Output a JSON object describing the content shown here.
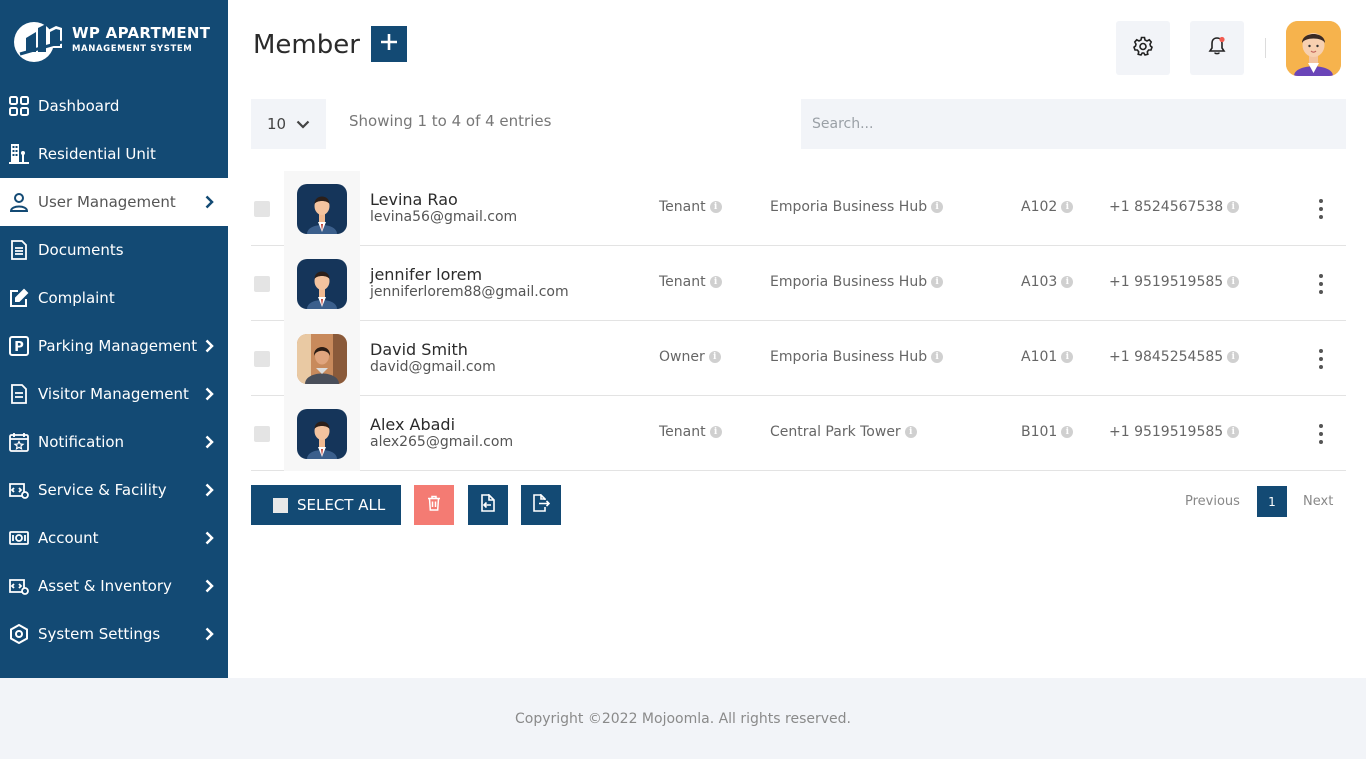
{
  "brand": {
    "title": "WP APARTMENT",
    "subtitle": "MANAGEMENT SYSTEM"
  },
  "sidebar": {
    "items": [
      {
        "label": "Dashboard",
        "icon": "dashboard-grid-icon",
        "has_chevron": false,
        "active": false
      },
      {
        "label": "Residential Unit",
        "icon": "building-icon",
        "has_chevron": false,
        "active": false
      },
      {
        "label": "User Management",
        "icon": "user-icon",
        "has_chevron": true,
        "active": true
      },
      {
        "label": "Documents",
        "icon": "document-icon",
        "has_chevron": false,
        "active": false
      },
      {
        "label": "Complaint",
        "icon": "edit-icon",
        "has_chevron": false,
        "active": false
      },
      {
        "label": "Parking Management",
        "icon": "parking-icon",
        "has_chevron": true,
        "active": false
      },
      {
        "label": "Visitor Management",
        "icon": "clipboard-icon",
        "has_chevron": true,
        "active": false
      },
      {
        "label": "Notification",
        "icon": "calendar-star-icon",
        "has_chevron": true,
        "active": false
      },
      {
        "label": "Service & Facility",
        "icon": "service-icon",
        "has_chevron": true,
        "active": false
      },
      {
        "label": "Account",
        "icon": "money-icon",
        "has_chevron": true,
        "active": false
      },
      {
        "label": "Asset & Inventory",
        "icon": "asset-icon",
        "has_chevron": true,
        "active": false
      },
      {
        "label": "System Settings",
        "icon": "settings-eye-icon",
        "has_chevron": true,
        "active": false
      }
    ]
  },
  "header": {
    "title": "Member",
    "add_icon": "plus-icon",
    "gear_icon": "gear-icon",
    "bell_icon": "bell-icon",
    "avatar": "user-avatar"
  },
  "controls": {
    "page_length": "10",
    "showing": "Showing 1 to 4 of 4 entries",
    "search_placeholder": "Search..."
  },
  "members": [
    {
      "name": "Levina Rao",
      "email": "levina56@gmail.com",
      "role": "Tenant",
      "building": "Emporia Business Hub",
      "unit": "A102",
      "phone": "+1 8524567538",
      "photo": "default"
    },
    {
      "name": "jennifer lorem",
      "email": "jenniferlorem88@gmail.com",
      "role": "Tenant",
      "building": "Emporia Business Hub",
      "unit": "A103",
      "phone": "+1 9519519585",
      "photo": "default"
    },
    {
      "name": "David Smith",
      "email": "david@gmail.com",
      "role": "Owner",
      "building": "Emporia Business Hub",
      "unit": "A101",
      "phone": "+1 9845254585",
      "photo": "photo"
    },
    {
      "name": "Alex Abadi",
      "email": "alex265@gmail.com",
      "role": "Tenant",
      "building": "Central Park Tower",
      "unit": "B101",
      "phone": "+1 9519519585",
      "photo": "default"
    }
  ],
  "actions": {
    "select_all": "SELECT ALL"
  },
  "pagination": {
    "previous": "Previous",
    "current": "1",
    "next": "Next"
  },
  "footer": {
    "copyright": "Copyright ©2022 Mojoomla. All rights reserved."
  },
  "colors": {
    "primary": "#134a74",
    "danger": "#f47b73",
    "panel": "#f2f4f8"
  }
}
